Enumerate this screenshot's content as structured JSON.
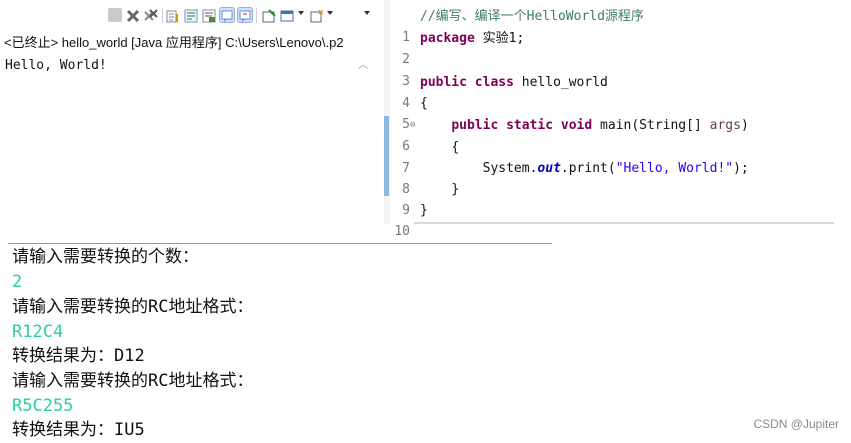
{
  "console": {
    "toolbar_icons": [
      "stop-terminate-icon",
      "remove-launch-icon",
      "remove-all-terminated-icon",
      "scroll-lock-icon",
      "word-wrap-icon",
      "show-console-on-output-icon",
      "show-console-on-error-icon",
      "pin-console-icon",
      "display-selected-console-icon",
      "open-console-icon"
    ],
    "header": "<已终止> hello_world [Java 应用程序] C:\\Users\\Lenovo\\.p2",
    "output_line": "Hello, World!"
  },
  "editor": {
    "lines": [
      {
        "n": "1",
        "text": "//编写、编译一个HelloWorld源程序"
      },
      {
        "n": "2",
        "kw": "package",
        "rest": " 实验1;"
      },
      {
        "n": "3"
      },
      {
        "n": "4",
        "kw1": "public",
        "kw2": "class",
        "rest": " hello_world"
      },
      {
        "n": "5",
        "rest": "{"
      },
      {
        "n": "6",
        "fold": "⊖",
        "kw1": "public",
        "kw2": "static",
        "kw3": "void",
        "rest": " main(String[] ",
        "arg": "args",
        "rest2": ")"
      },
      {
        "n": "7",
        "rest": "{"
      },
      {
        "n": "8",
        "pre": "System.",
        "fld": "out",
        "mid": ".print(",
        "str": "\"Hello, World!\"",
        "end": ");"
      },
      {
        "n": "9",
        "rest": "}"
      },
      {
        "n": "10",
        "rest": "}"
      }
    ]
  },
  "output": [
    {
      "text": "请输入需要转换的个数：",
      "input": false
    },
    {
      "text": "2",
      "input": true
    },
    {
      "text": "请输入需要转换的RC地址格式：",
      "input": false
    },
    {
      "text": "R12C4",
      "input": true
    },
    {
      "text": "转换结果为：D12",
      "input": false
    },
    {
      "text": "请输入需要转换的RC地址格式：",
      "input": false
    },
    {
      "text": "R5C255",
      "input": true
    },
    {
      "text": "转换结果为：IU5",
      "input": false
    }
  ],
  "watermark": "CSDN @Jupiter",
  "colors": {
    "input_green": "#2bd0a0",
    "keyword": "#7f0055",
    "comment": "#3f7f5f",
    "string": "#2a00ff",
    "field": "#0000c0"
  }
}
